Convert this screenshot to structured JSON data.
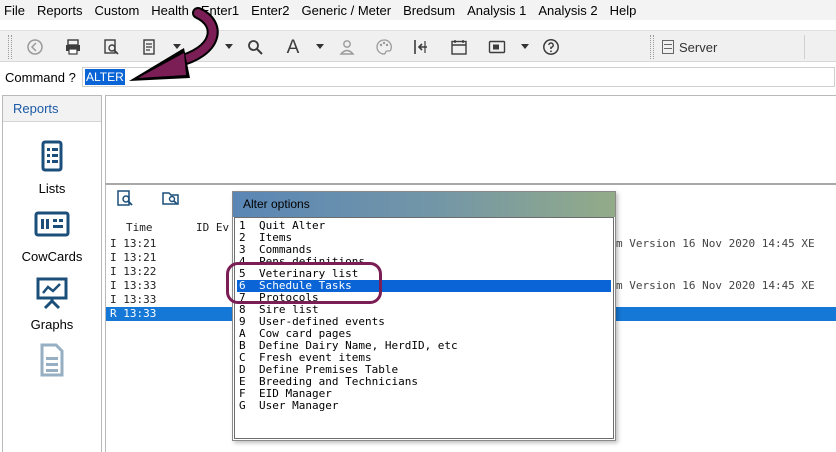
{
  "menu": [
    "File",
    "Reports",
    "Custom",
    "Health",
    "Enter1",
    "Enter2",
    "Generic / Meter",
    "Bredsum",
    "Analysis 1",
    "Analysis 2",
    "Help"
  ],
  "toolbar": {
    "server_label": "Server"
  },
  "command": {
    "label": "Command ?",
    "value": "ALTER"
  },
  "sidebar": {
    "title": "Reports",
    "items": [
      {
        "label": "Lists",
        "icon": "list-icon"
      },
      {
        "label": "CowCards",
        "icon": "cowcard-icon"
      },
      {
        "label": "Graphs",
        "icon": "graph-icon"
      },
      {
        "label": "",
        "icon": "spreadsheet-icon"
      }
    ]
  },
  "log": {
    "headers": [
      "Time",
      "ID Ev"
    ],
    "rows": [
      {
        "time": "I 13:21",
        "msg": "m Version 16 Nov 2020 14:45 XE"
      },
      {
        "time": "I 13:21",
        "msg": ""
      },
      {
        "time": "I 13:22",
        "msg": ""
      },
      {
        "time": "I 13:33",
        "msg": "m Version 16 Nov 2020 14:45 XE"
      },
      {
        "time": "I 13:33",
        "msg": ""
      },
      {
        "time": "R 13:33",
        "msg": ""
      }
    ]
  },
  "dialog": {
    "title": "Alter options",
    "options": [
      {
        "key": "1",
        "text": "Quit Alter"
      },
      {
        "key": "2",
        "text": "Items"
      },
      {
        "key": "3",
        "text": "Commands"
      },
      {
        "key": "4",
        "text": "Pens definitions"
      },
      {
        "key": "5",
        "text": "Veterinary list"
      },
      {
        "key": "6",
        "text": "Schedule Tasks"
      },
      {
        "key": "7",
        "text": "Protocols"
      },
      {
        "key": "8",
        "text": "Sire list"
      },
      {
        "key": "9",
        "text": "User-defined events"
      },
      {
        "key": "A",
        "text": "Cow card pages"
      },
      {
        "key": "B",
        "text": "Define Dairy Name, HerdID, etc"
      },
      {
        "key": "C",
        "text": "Fresh event items"
      },
      {
        "key": "D",
        "text": "Define Premises Table"
      },
      {
        "key": "E",
        "text": "Breeding and Technicians"
      },
      {
        "key": "F",
        "text": "EID Manager"
      },
      {
        "key": "G",
        "text": "User Manager"
      }
    ],
    "selected_key": "6"
  },
  "colors": {
    "selection": "#0a64d6",
    "annotation": "#7b1e55",
    "accent_text": "#1b5aa6"
  }
}
